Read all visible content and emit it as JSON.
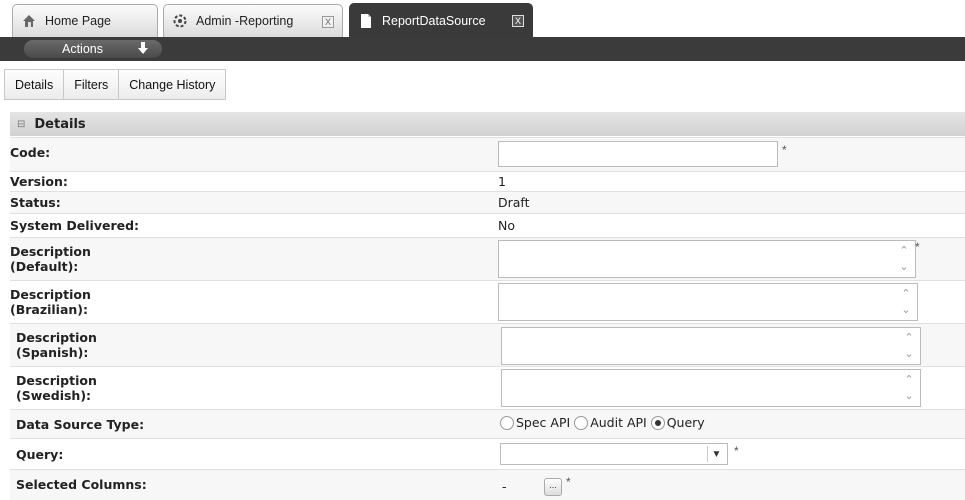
{
  "tabs": [
    {
      "label": "Home Page",
      "icon": "home-icon"
    },
    {
      "label": "Admin -Reporting",
      "icon": "gear-icon",
      "close": "X"
    },
    {
      "label": "ReportDataSource",
      "icon": "document-icon",
      "close": "X"
    }
  ],
  "toolbar": {
    "actions_label": "Actions"
  },
  "subtabs": [
    "Details",
    "Filters",
    "Change History"
  ],
  "details": {
    "section_title": "Details",
    "code": {
      "label": "Code:",
      "value": "",
      "required": "*"
    },
    "version": {
      "label": "Version:",
      "value": "1"
    },
    "status": {
      "label": "Status:",
      "value": "Draft"
    },
    "system_delivered": {
      "label": "System Delivered:",
      "value": "No"
    },
    "desc_default": {
      "label_line1": "Description",
      "label_line2": "(Default):",
      "required": "*"
    },
    "desc_brazilian": {
      "label_line1": "Description",
      "label_line2": "(Brazilian):"
    },
    "desc_spanish": {
      "label_line1": "Description",
      "label_line2": "(Spanish):"
    },
    "desc_swedish": {
      "label_line1": "Description",
      "label_line2": "(Swedish):"
    },
    "data_source_type": {
      "label": "Data Source Type:",
      "options": [
        {
          "label": "Spec API",
          "selected": false
        },
        {
          "label": "Audit API",
          "selected": false
        },
        {
          "label": "Query",
          "selected": true
        }
      ]
    },
    "query": {
      "label": "Query:",
      "value": "",
      "required": "*"
    },
    "selected_columns": {
      "label": "Selected Columns:",
      "value": "-",
      "button": "...",
      "required": "*"
    }
  }
}
